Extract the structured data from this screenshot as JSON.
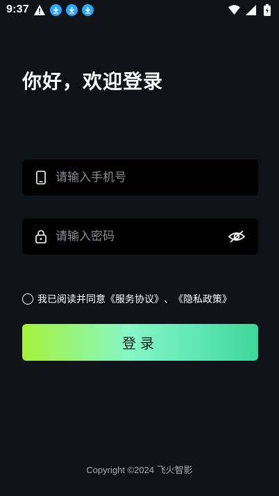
{
  "status_bar": {
    "time": "9:37",
    "icons": [
      "warning-icon",
      "download-icon",
      "download-icon",
      "download-icon",
      "wifi-icon",
      "signal-icon",
      "battery-icon"
    ]
  },
  "login": {
    "title": "你好，欢迎登录",
    "phone_placeholder": "请输入手机号",
    "password_placeholder": "请输入密码",
    "agreement_prefix": "我已阅读并同意",
    "service_agreement": "《服务协议》",
    "separator": "、",
    "privacy_policy": "《隐私政策》",
    "button_label": "登录"
  },
  "footer": {
    "copyright": "Copyright ©2024 飞火智影"
  },
  "colors": {
    "background": "#0f1217",
    "input_background": "#000000",
    "button_gradient_start": "#a6f23a",
    "button_gradient_end": "#3fd79a"
  }
}
